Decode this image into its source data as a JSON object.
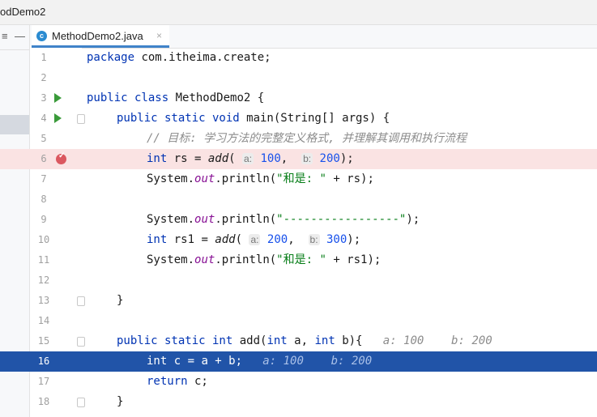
{
  "window": {
    "title": "odDemo2"
  },
  "sidebar": {
    "toolbar_left": "≡",
    "toolbar_dash": "—"
  },
  "tab": {
    "label": "MethodDemo2.java",
    "close": "×",
    "icon": "java-class-icon"
  },
  "line_numbers": [
    "1",
    "2",
    "3",
    "4",
    "5",
    "6",
    "7",
    "8",
    "9",
    "10",
    "11",
    "12",
    "13",
    "14",
    "15",
    "16",
    "17",
    "18"
  ],
  "code": {
    "l1_kw": "package",
    "l1_rest": " com.itheima.create;",
    "l3_kw": "public class",
    "l3_rest": " MethodDemo2 {",
    "l4_kw": "public static void",
    "l4_rest": " main(String[] args) {",
    "l5_comment": "// 目标: 学习方法的完整定义格式, 并理解其调用和执行流程",
    "l6_kw": "int",
    "l6_a": " rs = ",
    "l6_fn": "add",
    "l6_b": "( ",
    "l6_hint1": "a:",
    "l6_n1": "100",
    "l6_c": ",  ",
    "l6_hint2": "b:",
    "l6_n2": "200",
    "l6_d": ");",
    "l7_a": "System.",
    "l7_out": "out",
    "l7_b": ".println(",
    "l7_str": "\"和是: \"",
    "l7_c": " + rs);",
    "l9_a": "System.",
    "l9_out": "out",
    "l9_b": ".println(",
    "l9_str": "\"-----------------\"",
    "l9_c": ");",
    "l10_kw": "int",
    "l10_a": " rs1 = ",
    "l10_fn": "add",
    "l10_b": "( ",
    "l10_hint1": "a:",
    "l10_n1": "200",
    "l10_c": ",  ",
    "l10_hint2": "b:",
    "l10_n2": "300",
    "l10_d": ");",
    "l11_a": "System.",
    "l11_out": "out",
    "l11_b": ".println(",
    "l11_str": "\"和是: \"",
    "l11_c": " + rs1);",
    "l13": "}",
    "l15_kw1": "public static int",
    "l15_a": " add(",
    "l15_kw2": "int",
    "l15_b": " a, ",
    "l15_kw3": "int",
    "l15_c": " b){",
    "l15_dbg": "   a: 100    b: 200",
    "l16_kw": "int",
    "l16_a": " c = a + b;",
    "l16_dbg": "   a: 100    b: 200",
    "l17_kw": "return",
    "l17_a": " c;",
    "l18": "}"
  },
  "colors": {
    "keyword": "#0033b3",
    "number": "#1750eb",
    "string": "#067d17",
    "comment": "#8c8c8c",
    "breakpoint_line": "#fae3e3",
    "exec_line": "#2154a8",
    "breakpoint": "#db5860",
    "run_gutter": "#3a9a3a"
  }
}
